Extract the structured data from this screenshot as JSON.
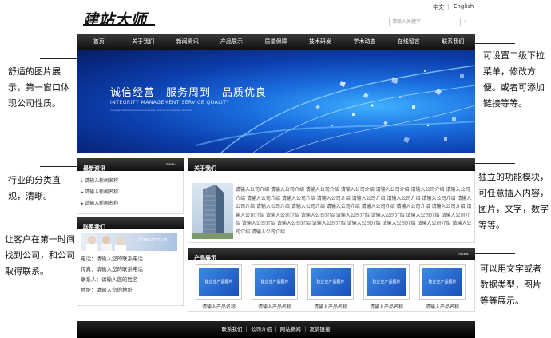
{
  "header": {
    "logo": "建站大师",
    "lang_cn": "中文",
    "lang_sep": "|",
    "lang_en": "English",
    "search_placeholder": "请输入关键字"
  },
  "nav": [
    "首页",
    "关于我们",
    "新闻资讯",
    "产品展示",
    "质量保障",
    "技术研发",
    "学术动态",
    "在线留言",
    "联系我们"
  ],
  "banner": {
    "slogan": "诚信经营　服务周到　品质优良",
    "subtitle": "INTEGRITY MANAGEMENT SERVICE QUALITY",
    "tiny": "integrity management service quality good service quality excellent"
  },
  "notes": {
    "left1": "舒适的图片展示，第一窗口体现公司性质。",
    "left2": "行业的分类直观，清晰。",
    "left3": "让客户在第一时间找到公司，和公司取得联系。",
    "right1": "可设置二级下拉菜单，修改方便。或者可添加链接等等。",
    "right2": "独立的功能模块，可任意插入内容，图片，文字，数字等等。",
    "right3": "可以用文字或者数据类型，图片等等展示。"
  },
  "news": {
    "title": "最新资讯",
    "more": "more ▸",
    "items": [
      "请输入新闻名称",
      "请输入新闻名称",
      "请输入新闻名称"
    ]
  },
  "contact": {
    "title": "联系我们",
    "image_text": "CONTACT US",
    "lines": [
      "电话：请输入您的联系电话",
      "传真：请输入您的联系电话",
      "联系人：请输入您的姓名",
      "地址：请输入您的地址"
    ]
  },
  "about": {
    "title": "关于我们",
    "text": "请输入公司介绍 请输入公司介绍 请输入公司介绍 请输入公司介绍 请输入公司介绍 请输入公司介绍 请输入公司介绍 请输入公司介绍 请输入公司介绍 请输入公司介绍 请输入公司介绍 请输入公司介绍 请输入公司介绍 请输入公司介绍 请输入公司介绍 请输入公司介绍 请输入公司介绍 请输入公司介绍 请输入公司介绍 请输入公司介绍 请输入公司介绍 请输入公司介绍 请输入公司介绍 请输入公司介绍 请输入公司介绍 请输入公司介绍 请输入公司介绍 请输入公司介绍 请输入公司介绍 请输入公司介绍 请输入公司介绍 请输入公司介绍 请输入公司介绍 请输入公司介绍 请输入公司介绍......"
  },
  "products": {
    "title": "产品展示",
    "more": "more ▸",
    "thumb_text": "建企业产品图片",
    "items": [
      "请输入产品名称",
      "请输入产品名称",
      "请输入产品名称",
      "请输入产品名称",
      "请输入产品名称"
    ]
  },
  "footer": "联系我们 ｜ 公司介绍 ｜ 网站新闻 ｜ 友情链接"
}
